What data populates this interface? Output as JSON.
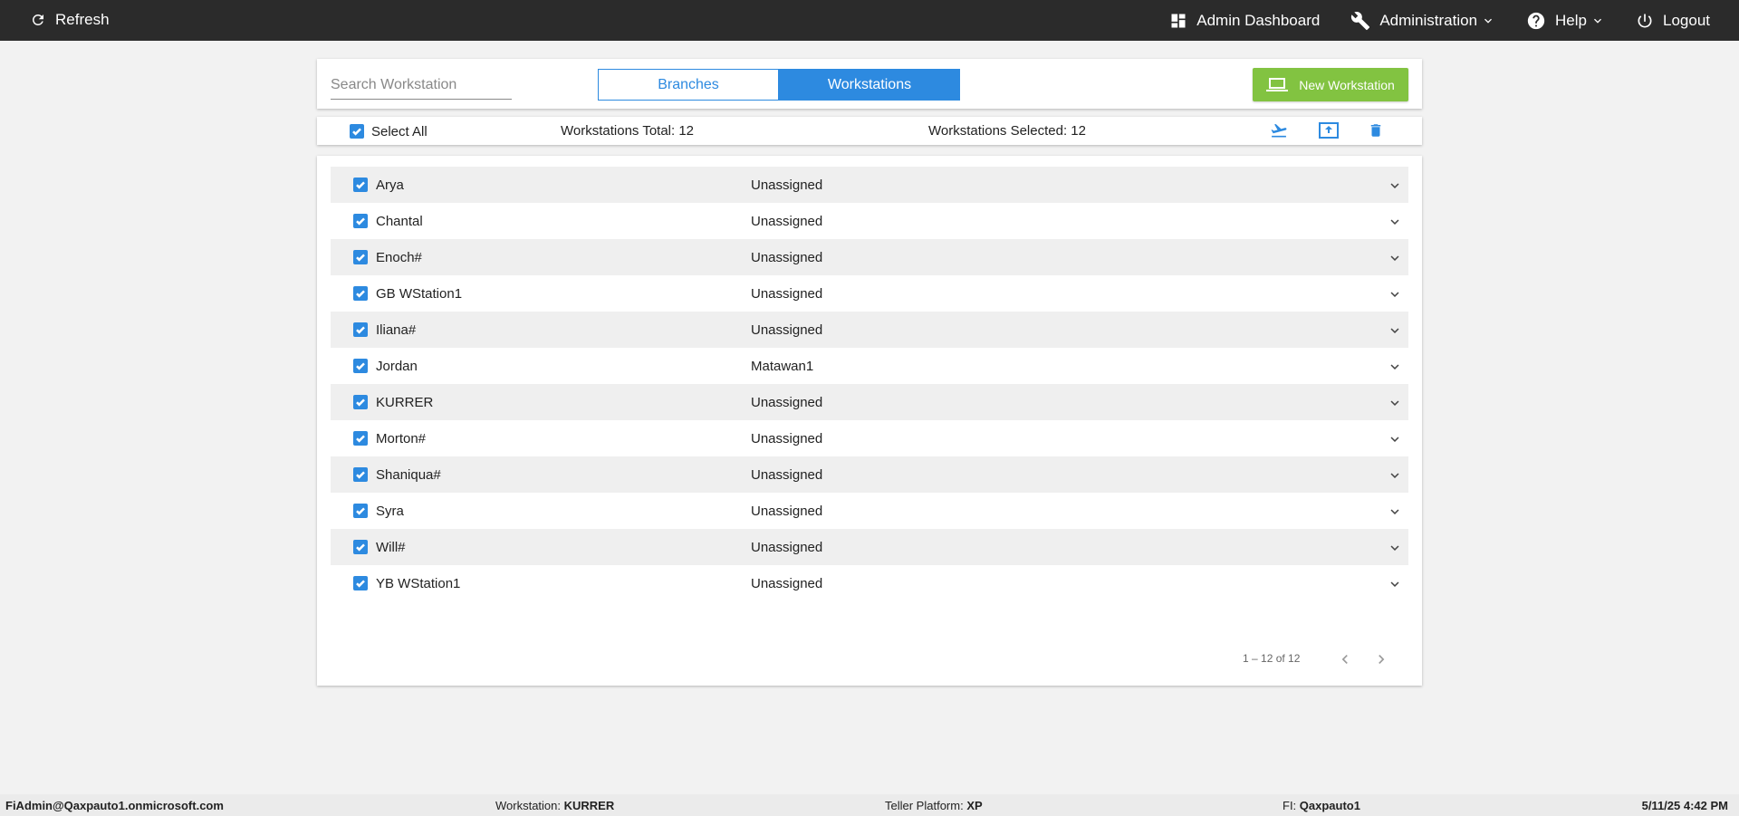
{
  "topbar": {
    "refresh_label": "Refresh",
    "admin_dashboard_label": "Admin Dashboard",
    "administration_label": "Administration",
    "help_label": "Help",
    "logout_label": "Logout"
  },
  "header": {
    "search_placeholder": "Search Workstation",
    "tabs": [
      {
        "label": "Branches",
        "active": false
      },
      {
        "label": "Workstations",
        "active": true
      }
    ],
    "new_button_label": "New Workstation"
  },
  "selection_bar": {
    "select_all_label": "Select All",
    "total_text": "Workstations Total: 12",
    "selected_text": "Workstations Selected: 12"
  },
  "workstations": [
    {
      "name": "Arya",
      "branch": "Unassigned"
    },
    {
      "name": "Chantal",
      "branch": "Unassigned"
    },
    {
      "name": "Enoch#",
      "branch": "Unassigned"
    },
    {
      "name": "GB WStation1",
      "branch": "Unassigned"
    },
    {
      "name": "Iliana#",
      "branch": "Unassigned"
    },
    {
      "name": "Jordan",
      "branch": "Matawan1"
    },
    {
      "name": "KURRER",
      "branch": "Unassigned"
    },
    {
      "name": "Morton#",
      "branch": "Unassigned"
    },
    {
      "name": "Shaniqua#",
      "branch": "Unassigned"
    },
    {
      "name": "Syra",
      "branch": "Unassigned"
    },
    {
      "name": "Will#",
      "branch": "Unassigned"
    },
    {
      "name": "YB WStation1",
      "branch": "Unassigned"
    }
  ],
  "pagination": {
    "range_text": "1 – 12 of 12"
  },
  "footer": {
    "user": "FiAdmin@Qaxpauto1.onmicrosoft.com",
    "workstation_label": "Workstation: ",
    "workstation_value": "KURRER",
    "platform_label": "Teller Platform: ",
    "platform_value": "XP",
    "fi_label": "FI: ",
    "fi_value": "Qaxpauto1",
    "datetime": "5/11/25 4:42 PM"
  },
  "colors": {
    "accent": "#2d8ae0",
    "new_button": "#82c341",
    "topbar": "#2b2b2b"
  }
}
